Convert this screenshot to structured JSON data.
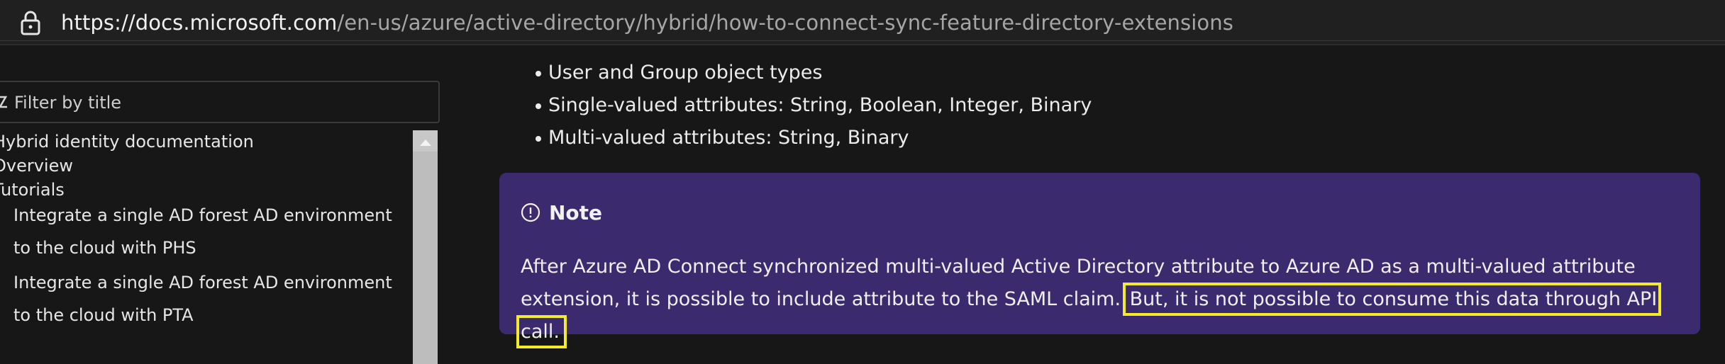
{
  "browser": {
    "url_host": "https://docs.microsoft.com",
    "url_path": "/en-us/azure/active-directory/hybrid/how-to-connect-sync-feature-directory-extensions"
  },
  "sidebar": {
    "filter_placeholder": "Filter by title",
    "items": [
      {
        "label": "Hybrid identity documentation"
      },
      {
        "label": "Overview"
      },
      {
        "label": "Tutorials"
      },
      {
        "label": "Integrate a single AD forest AD environment to the cloud with PHS"
      },
      {
        "label": "Integrate a single AD forest AD environment to the cloud with PTA"
      }
    ]
  },
  "main": {
    "bullets": [
      "User and Group object types",
      "Single-valued attributes: String, Boolean, Integer, Binary",
      "Multi-valued attributes: String, Binary"
    ],
    "note": {
      "title": "Note",
      "text_before": "After Azure AD Connect synchronized multi-valued Active Directory attribute to Azure AD as a multi-valued attribute extension, it is possible to include attribute to the SAML claim. ",
      "text_highlight": "But, it is not possible to consume this data through API call."
    }
  },
  "colors": {
    "background": "#171717",
    "note_background": "#3b2a6e",
    "highlight_box": "#f2ea2a"
  }
}
